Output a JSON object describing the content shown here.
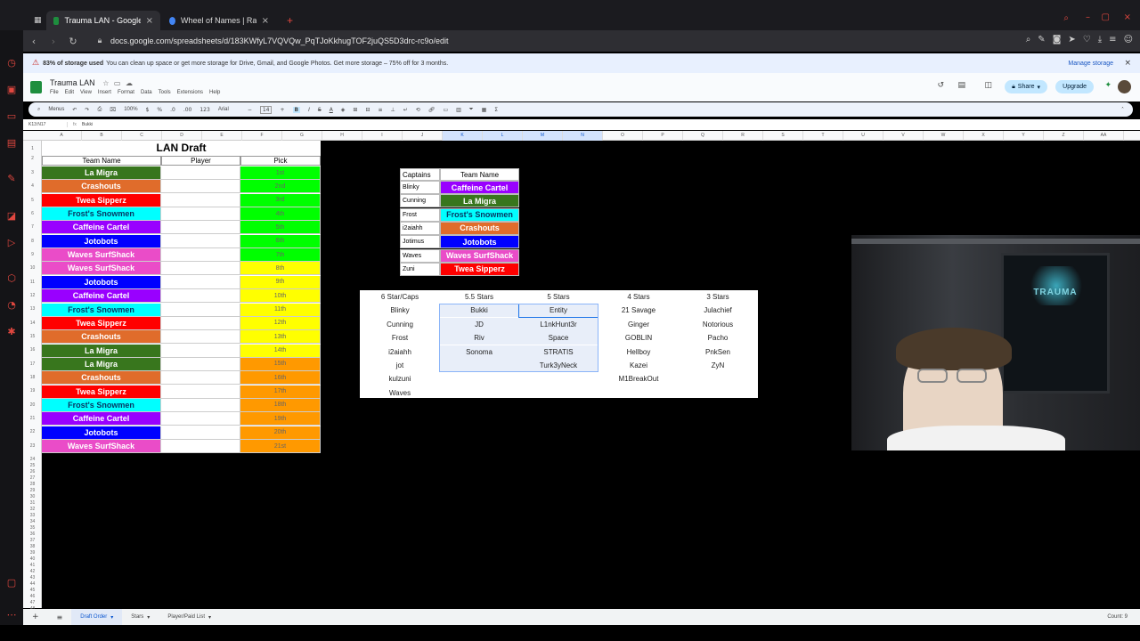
{
  "browser": {
    "tabs": [
      {
        "title": "Trauma LAN - Google Sheets",
        "active": true,
        "favicon_color": "#1e8e3e"
      },
      {
        "title": "Wheel of Names | Random",
        "active": false,
        "favicon_color": "#4285f4"
      }
    ],
    "new_tab_label": "+",
    "url": "docs.google.com/spreadsheets/d/183KWfyL7VQVQw_PqTJoKkhugTOF2juQS5D3drc-rc9o/edit"
  },
  "banner": {
    "bold": "83% of storage used",
    "text": "You can clean up space or get more storage for Drive, Gmail, and Google Photos. Get more storage – 75% off for 3 months.",
    "action": "Manage storage"
  },
  "sheet": {
    "title": "Trauma LAN",
    "menus": [
      "File",
      "Edit",
      "View",
      "Insert",
      "Format",
      "Data",
      "Tools",
      "Extensions",
      "Help"
    ],
    "share_label": "Share",
    "upgrade_label": "Upgrade",
    "toolbar": {
      "menus": "Menus",
      "zoom": "100%",
      "currency": "$",
      "percent": "%",
      "dec1": ".0",
      "dec2": ".00",
      "num": "123",
      "font": "Arial",
      "font_size": "14"
    },
    "cell_ref": "K13:N17",
    "formula": "Bukki"
  },
  "columns": [
    "A",
    "B",
    "C",
    "D",
    "E",
    "F",
    "G",
    "H",
    "I",
    "J",
    "K",
    "L",
    "M",
    "N",
    "O",
    "P",
    "Q",
    "R",
    "S",
    "T",
    "U",
    "V",
    "W",
    "X",
    "Y",
    "Z",
    "AA"
  ],
  "draft": {
    "title": "LAN Draft",
    "headers": {
      "team": "Team Name",
      "player": "Player",
      "pick": "Pick"
    },
    "rows": [
      {
        "team": "La Migra",
        "pick": "1st",
        "team_bg": "#38761d",
        "team_fg": "#ffffff",
        "pick_bg": "#00ff00"
      },
      {
        "team": "Crashouts",
        "pick": "2nd",
        "team_bg": "#e06c2b",
        "team_fg": "#ffffff",
        "pick_bg": "#00ff00"
      },
      {
        "team": "Twea Sipperz",
        "pick": "3rd",
        "team_bg": "#ff0000",
        "team_fg": "#ffffff",
        "pick_bg": "#00ff00"
      },
      {
        "team": "Frost's Snowmen",
        "pick": "4th",
        "team_bg": "#00ffff",
        "team_fg": "#073763",
        "pick_bg": "#00ff00"
      },
      {
        "team": "Caffeine Cartel",
        "pick": "5th",
        "team_bg": "#9900ff",
        "team_fg": "#ffffff",
        "pick_bg": "#00ff00"
      },
      {
        "team": "Jotobots",
        "pick": "6th",
        "team_bg": "#0000ff",
        "team_fg": "#ffffff",
        "pick_bg": "#00ff00"
      },
      {
        "team": "Waves SurfShack",
        "pick": "7th",
        "team_bg": "#ea4cc8",
        "team_fg": "#ffffff",
        "pick_bg": "#00ff00"
      },
      {
        "team": "Waves SurfShack",
        "pick": "8th",
        "team_bg": "#ea4cc8",
        "team_fg": "#ffffff",
        "pick_bg": "#ffff00"
      },
      {
        "team": "Jotobots",
        "pick": "9th",
        "team_bg": "#0000ff",
        "team_fg": "#ffffff",
        "pick_bg": "#ffff00"
      },
      {
        "team": "Caffeine Cartel",
        "pick": "10th",
        "team_bg": "#9900ff",
        "team_fg": "#ffffff",
        "pick_bg": "#ffff00"
      },
      {
        "team": "Frost's Snowmen",
        "pick": "11th",
        "team_bg": "#00ffff",
        "team_fg": "#073763",
        "pick_bg": "#ffff00"
      },
      {
        "team": "Twea Sipperz",
        "pick": "12th",
        "team_bg": "#ff0000",
        "team_fg": "#ffffff",
        "pick_bg": "#ffff00"
      },
      {
        "team": "Crashouts",
        "pick": "13th",
        "team_bg": "#e06c2b",
        "team_fg": "#ffffff",
        "pick_bg": "#ffff00"
      },
      {
        "team": "La Migra",
        "pick": "14th",
        "team_bg": "#38761d",
        "team_fg": "#ffffff",
        "pick_bg": "#ffff00"
      },
      {
        "team": "La Migra",
        "pick": "15th",
        "team_bg": "#38761d",
        "team_fg": "#ffffff",
        "pick_bg": "#ff9900"
      },
      {
        "team": "Crashouts",
        "pick": "16th",
        "team_bg": "#e06c2b",
        "team_fg": "#ffffff",
        "pick_bg": "#ff9900"
      },
      {
        "team": "Twea Sipperz",
        "pick": "17th",
        "team_bg": "#ff0000",
        "team_fg": "#ffffff",
        "pick_bg": "#ff9900"
      },
      {
        "team": "Frost's Snowmen",
        "pick": "18th",
        "team_bg": "#00ffff",
        "team_fg": "#073763",
        "pick_bg": "#ff9900"
      },
      {
        "team": "Caffeine Cartel",
        "pick": "19th",
        "team_bg": "#9900ff",
        "team_fg": "#ffffff",
        "pick_bg": "#ff9900"
      },
      {
        "team": "Jotobots",
        "pick": "20th",
        "team_bg": "#0000ff",
        "team_fg": "#ffffff",
        "pick_bg": "#ff9900"
      },
      {
        "team": "Waves SurfShack",
        "pick": "21st",
        "team_bg": "#ea4cc8",
        "team_fg": "#ffffff",
        "pick_bg": "#ff9900"
      }
    ]
  },
  "captains": {
    "headers": {
      "captain": "Captains",
      "team": "Team Name"
    },
    "rows": [
      {
        "captain": "Blinky",
        "team": "Caffeine Cartel",
        "bg": "#9900ff",
        "fg": "#ffffff"
      },
      {
        "captain": "Cunning",
        "team": "La Migra",
        "bg": "#38761d",
        "fg": "#ffffff"
      },
      {
        "captain": "Frost",
        "team": "Frost's Snowmen",
        "bg": "#00ffff",
        "fg": "#073763"
      },
      {
        "captain": "i2aiahh",
        "team": "Crashouts",
        "bg": "#e06c2b",
        "fg": "#ffffff"
      },
      {
        "captain": "Jotimus",
        "team": "Jotobots",
        "bg": "#0000ff",
        "fg": "#ffffff"
      },
      {
        "captain": "Waves",
        "team": "Waves SurfShack",
        "bg": "#ea4cc8",
        "fg": "#ffffff"
      },
      {
        "captain": "Zuni",
        "team": "Twea Sipperz",
        "bg": "#ff0000",
        "fg": "#ffffff"
      }
    ]
  },
  "stars": {
    "headers": [
      "6 Star/Caps",
      "5.5 Stars",
      "5 Stars",
      "4 Stars",
      "3 Stars"
    ],
    "rows": [
      [
        "Blinky",
        "Bukki",
        "Entity",
        "21 Savage",
        "Julachief"
      ],
      [
        "Cunning",
        "JD",
        "L1nkHunt3r",
        "Ginger",
        "Notorious"
      ],
      [
        "Frost",
        "Riv",
        "Space",
        "GOBLIN",
        "Pacho"
      ],
      [
        "i2aiahh",
        "Sonoma",
        "STRATIS",
        "Hellboy",
        "PnkSen"
      ],
      [
        "jot",
        "",
        "Turk3yNeck",
        "Kazei",
        "ZyN"
      ],
      [
        "kulzuni",
        "",
        "",
        "M1BreakOut",
        ""
      ],
      [
        "Waves",
        "",
        "",
        "",
        ""
      ]
    ]
  },
  "webcam": {
    "poster_text": "TRAUMA"
  },
  "sheet_tabs": [
    {
      "label": "Draft Order",
      "active": true
    },
    {
      "label": "Stars",
      "active": false
    },
    {
      "label": "Player/Paid List",
      "active": false
    }
  ],
  "status": {
    "count": "Count: 9"
  }
}
